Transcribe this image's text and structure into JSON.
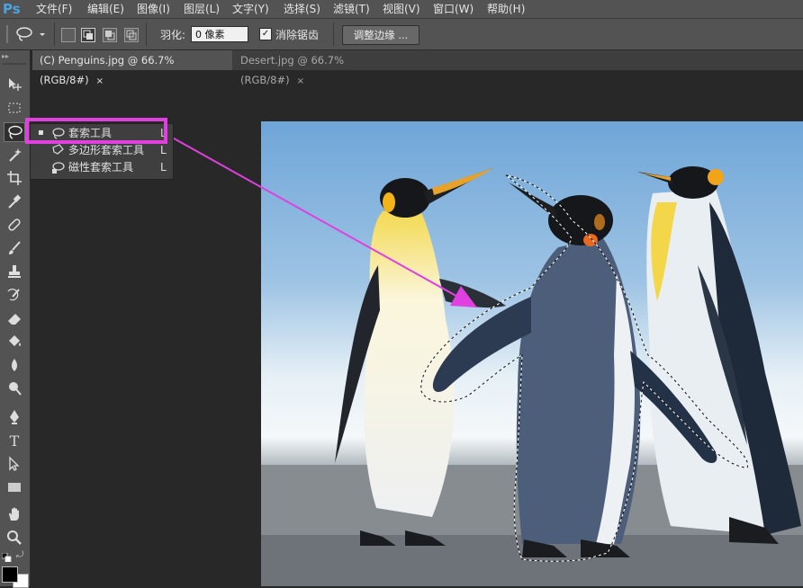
{
  "app": {
    "logo": "Ps"
  },
  "menu": [
    "文件(F)",
    "编辑(E)",
    "图像(I)",
    "图层(L)",
    "文字(Y)",
    "选择(S)",
    "滤镜(T)",
    "视图(V)",
    "窗口(W)",
    "帮助(H)"
  ],
  "options": {
    "feather_label": "羽化:",
    "feather_value": "0 像素",
    "antialias_label": "消除锯齿",
    "antialias_checked": "✓",
    "refine_edge": "调整边缘 ..."
  },
  "tabs": [
    {
      "label": "(C) Penguins.jpg @ 66.7%(RGB/8#)",
      "close": "×"
    },
    {
      "label": "Desert.jpg @ 66.7%(RGB/8#)",
      "close": "×"
    }
  ],
  "flyout": [
    {
      "label": "套索工具",
      "key": "L",
      "active": true,
      "bullet": "▪"
    },
    {
      "label": "多边形套索工具",
      "key": "L"
    },
    {
      "label": "磁性套索工具",
      "key": "L"
    }
  ],
  "colors": {
    "highlight": "#e040e0",
    "accent": "#4aa3df"
  },
  "icons": {
    "tools": [
      "move-icon",
      "marquee-icon",
      "lasso-icon",
      "magic-wand-icon",
      "crop-icon",
      "eyedropper-icon",
      "spot-heal-icon",
      "brush-icon",
      "stamp-icon",
      "history-brush-icon",
      "eraser-icon",
      "bucket-icon",
      "blur-icon",
      "dodge-icon",
      "pen-icon",
      "type-icon",
      "path-select-icon",
      "shape-icon",
      "hand-icon",
      "zoom-icon"
    ]
  }
}
